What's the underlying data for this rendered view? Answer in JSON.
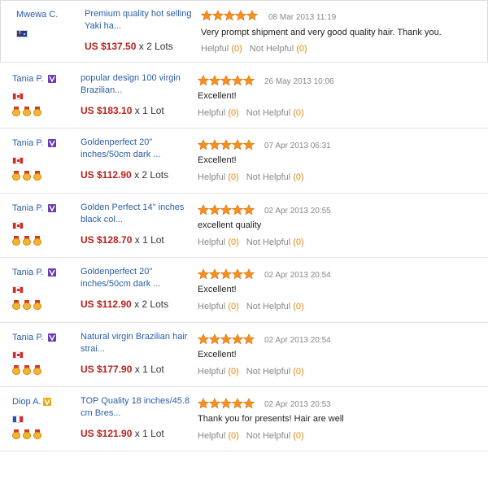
{
  "icons": {
    "star": "star-icon",
    "vip": "vip-badge-icon",
    "medal": "medal-icon",
    "flags": {
      "AU": "australia-flag-icon",
      "CA": "canada-flag-icon",
      "FR": "france-flag-icon"
    }
  },
  "colors": {
    "link": "#2a5da8",
    "price": "#b8201b",
    "star": "#f5901e",
    "helpful_count": "#e28a0e"
  },
  "reviews": [
    {
      "buyer": "Mwewa C.",
      "country_flag": "AU",
      "vip_badge": null,
      "medal_count": 0,
      "product": "Premium quality hot selling Yaki ha...",
      "price": "US $137.50",
      "quantity": "x 2 Lots",
      "stars": 5,
      "date": "08 Mar 2013 11:19",
      "text": "Very prompt shipment and very good quality hair. Thank you.",
      "helpful_label": "Helpful",
      "helpful_count": "(0)",
      "not_helpful_label": "Not Helpful",
      "not_helpful_count": "(0)"
    },
    {
      "buyer": "Tania P.",
      "country_flag": "CA",
      "vip_badge": "purple",
      "medal_count": 3,
      "product": "popular design 100 virgin Brazilian...",
      "price": "US $183.10",
      "quantity": "x 1 Lot",
      "stars": 5,
      "date": "26 May 2013 10:06",
      "text": "Excellent!",
      "helpful_label": "Helpful",
      "helpful_count": "(0)",
      "not_helpful_label": "Not Helpful",
      "not_helpful_count": "(0)"
    },
    {
      "buyer": "Tania P.",
      "country_flag": "CA",
      "vip_badge": "purple",
      "medal_count": 3,
      "product": "Goldenperfect 20\" inches/50cm dark ...",
      "price": "US $112.90",
      "quantity": "x 2 Lots",
      "stars": 5,
      "date": "07 Apr 2013 06:31",
      "text": "Excellent!",
      "helpful_label": "Helpful",
      "helpful_count": "(0)",
      "not_helpful_label": "Not Helpful",
      "not_helpful_count": "(0)"
    },
    {
      "buyer": "Tania P.",
      "country_flag": "CA",
      "vip_badge": "purple",
      "medal_count": 3,
      "product": "Golden Perfect 14\" inches black col...",
      "price": "US $128.70",
      "quantity": "x 1 Lot",
      "stars": 5,
      "date": "02 Apr 2013 20:55",
      "text": "excellent quality",
      "helpful_label": "Helpful",
      "helpful_count": "(0)",
      "not_helpful_label": "Not Helpful",
      "not_helpful_count": "(0)"
    },
    {
      "buyer": "Tania P.",
      "country_flag": "CA",
      "vip_badge": "purple",
      "medal_count": 3,
      "product": "Goldenperfect 20\" inches/50cm dark ...",
      "price": "US $112.90",
      "quantity": "x 2 Lots",
      "stars": 5,
      "date": "02 Apr 2013 20:54",
      "text": "Excellent!",
      "helpful_label": "Helpful",
      "helpful_count": "(0)",
      "not_helpful_label": "Not Helpful",
      "not_helpful_count": "(0)"
    },
    {
      "buyer": "Tania P.",
      "country_flag": "CA",
      "vip_badge": "purple",
      "medal_count": 3,
      "product": "Natural virgin Brazilian hair strai...",
      "price": "US $177.90",
      "quantity": "x 1 Lot",
      "stars": 5,
      "date": "02 Apr 2013 20:54",
      "text": "Excellent!",
      "helpful_label": "Helpful",
      "helpful_count": "(0)",
      "not_helpful_label": "Not Helpful",
      "not_helpful_count": "(0)"
    },
    {
      "buyer": "Diop A.",
      "country_flag": "FR",
      "vip_badge": "gold",
      "medal_count": 3,
      "product": "TOP Quality 18 inches/45.8 cm Bres...",
      "price": "US $121.90",
      "quantity": "x 1 Lot",
      "stars": 5,
      "date": "02 Apr 2013 20:53",
      "text": "Thank you for presents! Hair are well",
      "helpful_label": "Helpful",
      "helpful_count": "(0)",
      "not_helpful_label": "Not Helpful",
      "not_helpful_count": "(0)"
    }
  ]
}
